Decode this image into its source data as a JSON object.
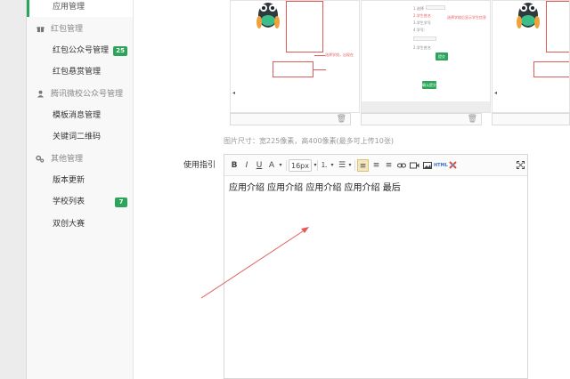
{
  "sidebar": {
    "active_item": "应用管理",
    "groups": [
      {
        "label": "红包管理",
        "icon": "gift-icon",
        "items": [
          {
            "label": "红包公众号管理",
            "badge": "25"
          },
          {
            "label": "红包悬赏管理",
            "badge": ""
          }
        ]
      },
      {
        "label": "腾讯微校公众号管理",
        "icon": "user-icon",
        "items": [
          {
            "label": "模板消息管理",
            "badge": ""
          },
          {
            "label": "关键词二维码",
            "badge": ""
          }
        ]
      },
      {
        "label": "其他管理",
        "icon": "gears-icon",
        "items": [
          {
            "label": "版本更新",
            "badge": ""
          },
          {
            "label": "学校列表",
            "badge": "7"
          },
          {
            "label": "双创大赛",
            "badge": ""
          }
        ]
      }
    ]
  },
  "upload": {
    "hint": "图片尺寸：宽225像素，高400像素(最多可上传10张)",
    "preview_note_1": "选择学校，出现在",
    "preview_note_2": "选择学校后显示学生信息",
    "preview_form": {
      "row1": "1.选择",
      "row2": "2.学生姓名",
      "row3": "3.学生学号",
      "row4": "4.学号：",
      "submit": "提交",
      "confirm": "确认提交"
    }
  },
  "guide": {
    "label": "使用指引",
    "toolbar": {
      "bold": "B",
      "italic": "I",
      "underline": "U",
      "font_color": "A",
      "font_size": "16px",
      "html": "HTML"
    },
    "content": "应用介绍  应用介绍  应用介绍  应用介绍  最后"
  },
  "colors": {
    "accent": "#2aa55a",
    "annotation": "#e05a5a"
  }
}
